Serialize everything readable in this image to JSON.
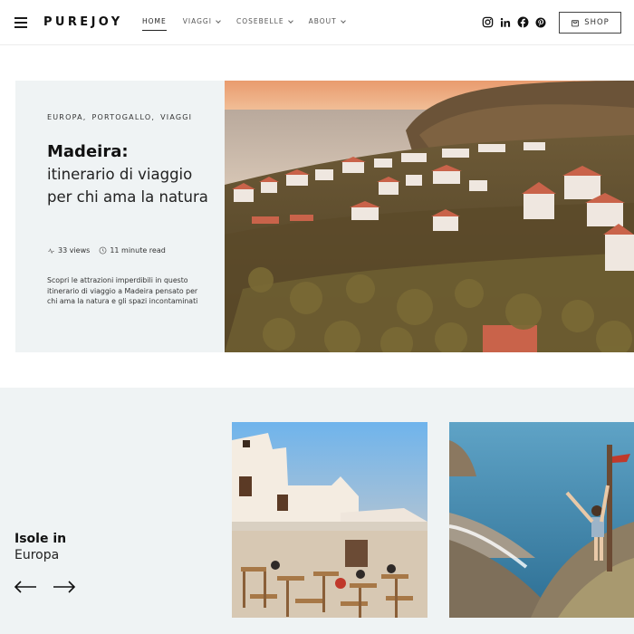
{
  "header": {
    "logo": "PUREJOY",
    "nav": [
      {
        "label": "HOME",
        "active": true
      },
      {
        "label": "VIAGGI",
        "dropdown": true
      },
      {
        "label": "COSEBELLE",
        "dropdown": true
      },
      {
        "label": "ABOUT",
        "dropdown": true
      }
    ],
    "socials": [
      "instagram-icon",
      "linkedin-icon",
      "facebook-icon",
      "pinterest-icon"
    ],
    "shop_label": "SHOP"
  },
  "hero": {
    "categories": [
      "EUROPA,",
      "PORTOGALLO,",
      "VIAGGI"
    ],
    "title_bold": "Madeira:",
    "title_rest": "itinerario di viaggio per chi ama la natura",
    "views": "33 views",
    "read_time": "11 minute read",
    "excerpt": "Scopri le attrazioni imperdibili in questo itinerario di viaggio a Madeira pensato per chi ama la natura e gli spazi incontaminati"
  },
  "section": {
    "title_line1": "Isole in",
    "title_line2": "Europa"
  },
  "colors": {
    "panel_bg": "#eff3f4",
    "text": "#1a1a1a"
  }
}
